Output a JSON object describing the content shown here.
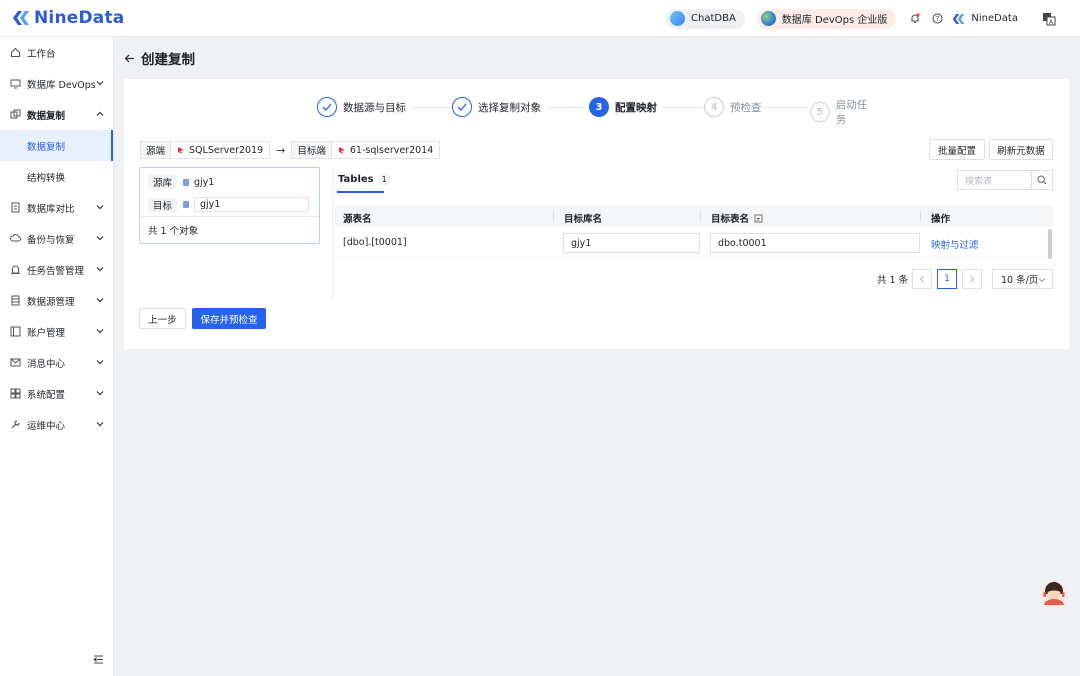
{
  "app": {
    "logo_text": "NineData"
  },
  "topbar": {
    "chatdba": "ChatDBA",
    "edition": "数据库 DevOps 企业版",
    "user": "NineData"
  },
  "sidebar": {
    "items": [
      {
        "label": "工作台",
        "icon": "home-icon"
      },
      {
        "label": "数据库 DevOps",
        "icon": "monitor-icon",
        "chevron": "down"
      },
      {
        "label": "数据复制",
        "icon": "copy-icon",
        "chevron": "up"
      },
      {
        "label": "数据库对比",
        "icon": "compare-icon",
        "chevron": "down"
      },
      {
        "label": "备份与恢复",
        "icon": "backup-icon",
        "chevron": "down"
      },
      {
        "label": "任务告警管理",
        "icon": "alarm-icon",
        "chevron": "down"
      },
      {
        "label": "数据源管理",
        "icon": "database-icon",
        "chevron": "down"
      },
      {
        "label": "账户管理",
        "icon": "account-icon",
        "chevron": "down"
      },
      {
        "label": "消息中心",
        "icon": "mail-icon",
        "chevron": "down"
      },
      {
        "label": "系统配置",
        "icon": "grid-icon",
        "chevron": "down"
      },
      {
        "label": "运维中心",
        "icon": "wrench-icon",
        "chevron": "down"
      }
    ],
    "sub_items": [
      "数据复制",
      "结构转换"
    ]
  },
  "page": {
    "title": "创建复制"
  },
  "steps": [
    {
      "num": "1",
      "label": "数据源与目标",
      "state": "done"
    },
    {
      "num": "2",
      "label": "选择复制对象",
      "state": "done"
    },
    {
      "num": "3",
      "label": "配置映射",
      "state": "current"
    },
    {
      "num": "4",
      "label": "预检查",
      "state": "todo"
    },
    {
      "num": "5",
      "label": "启动任务",
      "state": "todo"
    }
  ],
  "source_bar": {
    "source_label": "源端",
    "source_value": "SQLServer2019",
    "target_label": "目标端",
    "target_value": "61-sqlserver2014"
  },
  "actions": {
    "batch_config": "批量配置",
    "refresh_meta": "刷新元数据"
  },
  "left_panel": {
    "src_db_label": "源库",
    "src_db_value": "gjy1",
    "target_label": "目标",
    "target_value": "gjy1",
    "footer": "共 1 个对象"
  },
  "tables_tab": {
    "label": "Tables",
    "count": "1"
  },
  "search": {
    "placeholder": "搜索表"
  },
  "table": {
    "columns": [
      "源表名",
      "目标库名",
      "目标表名",
      "操作"
    ],
    "rows": [
      {
        "source_table": "[dbo].[t0001]",
        "target_db": "gjy1",
        "target_table": "dbo.t0001",
        "action": "映射与过滤"
      }
    ]
  },
  "pagination": {
    "total": "共 1 条",
    "current_page": "1",
    "page_size": "10 条/页"
  },
  "footer_buttons": {
    "prev": "上一步",
    "save_check": "保存并预检查"
  },
  "colors": {
    "primary": "#2563eb",
    "brand": "#2c5bd4"
  }
}
